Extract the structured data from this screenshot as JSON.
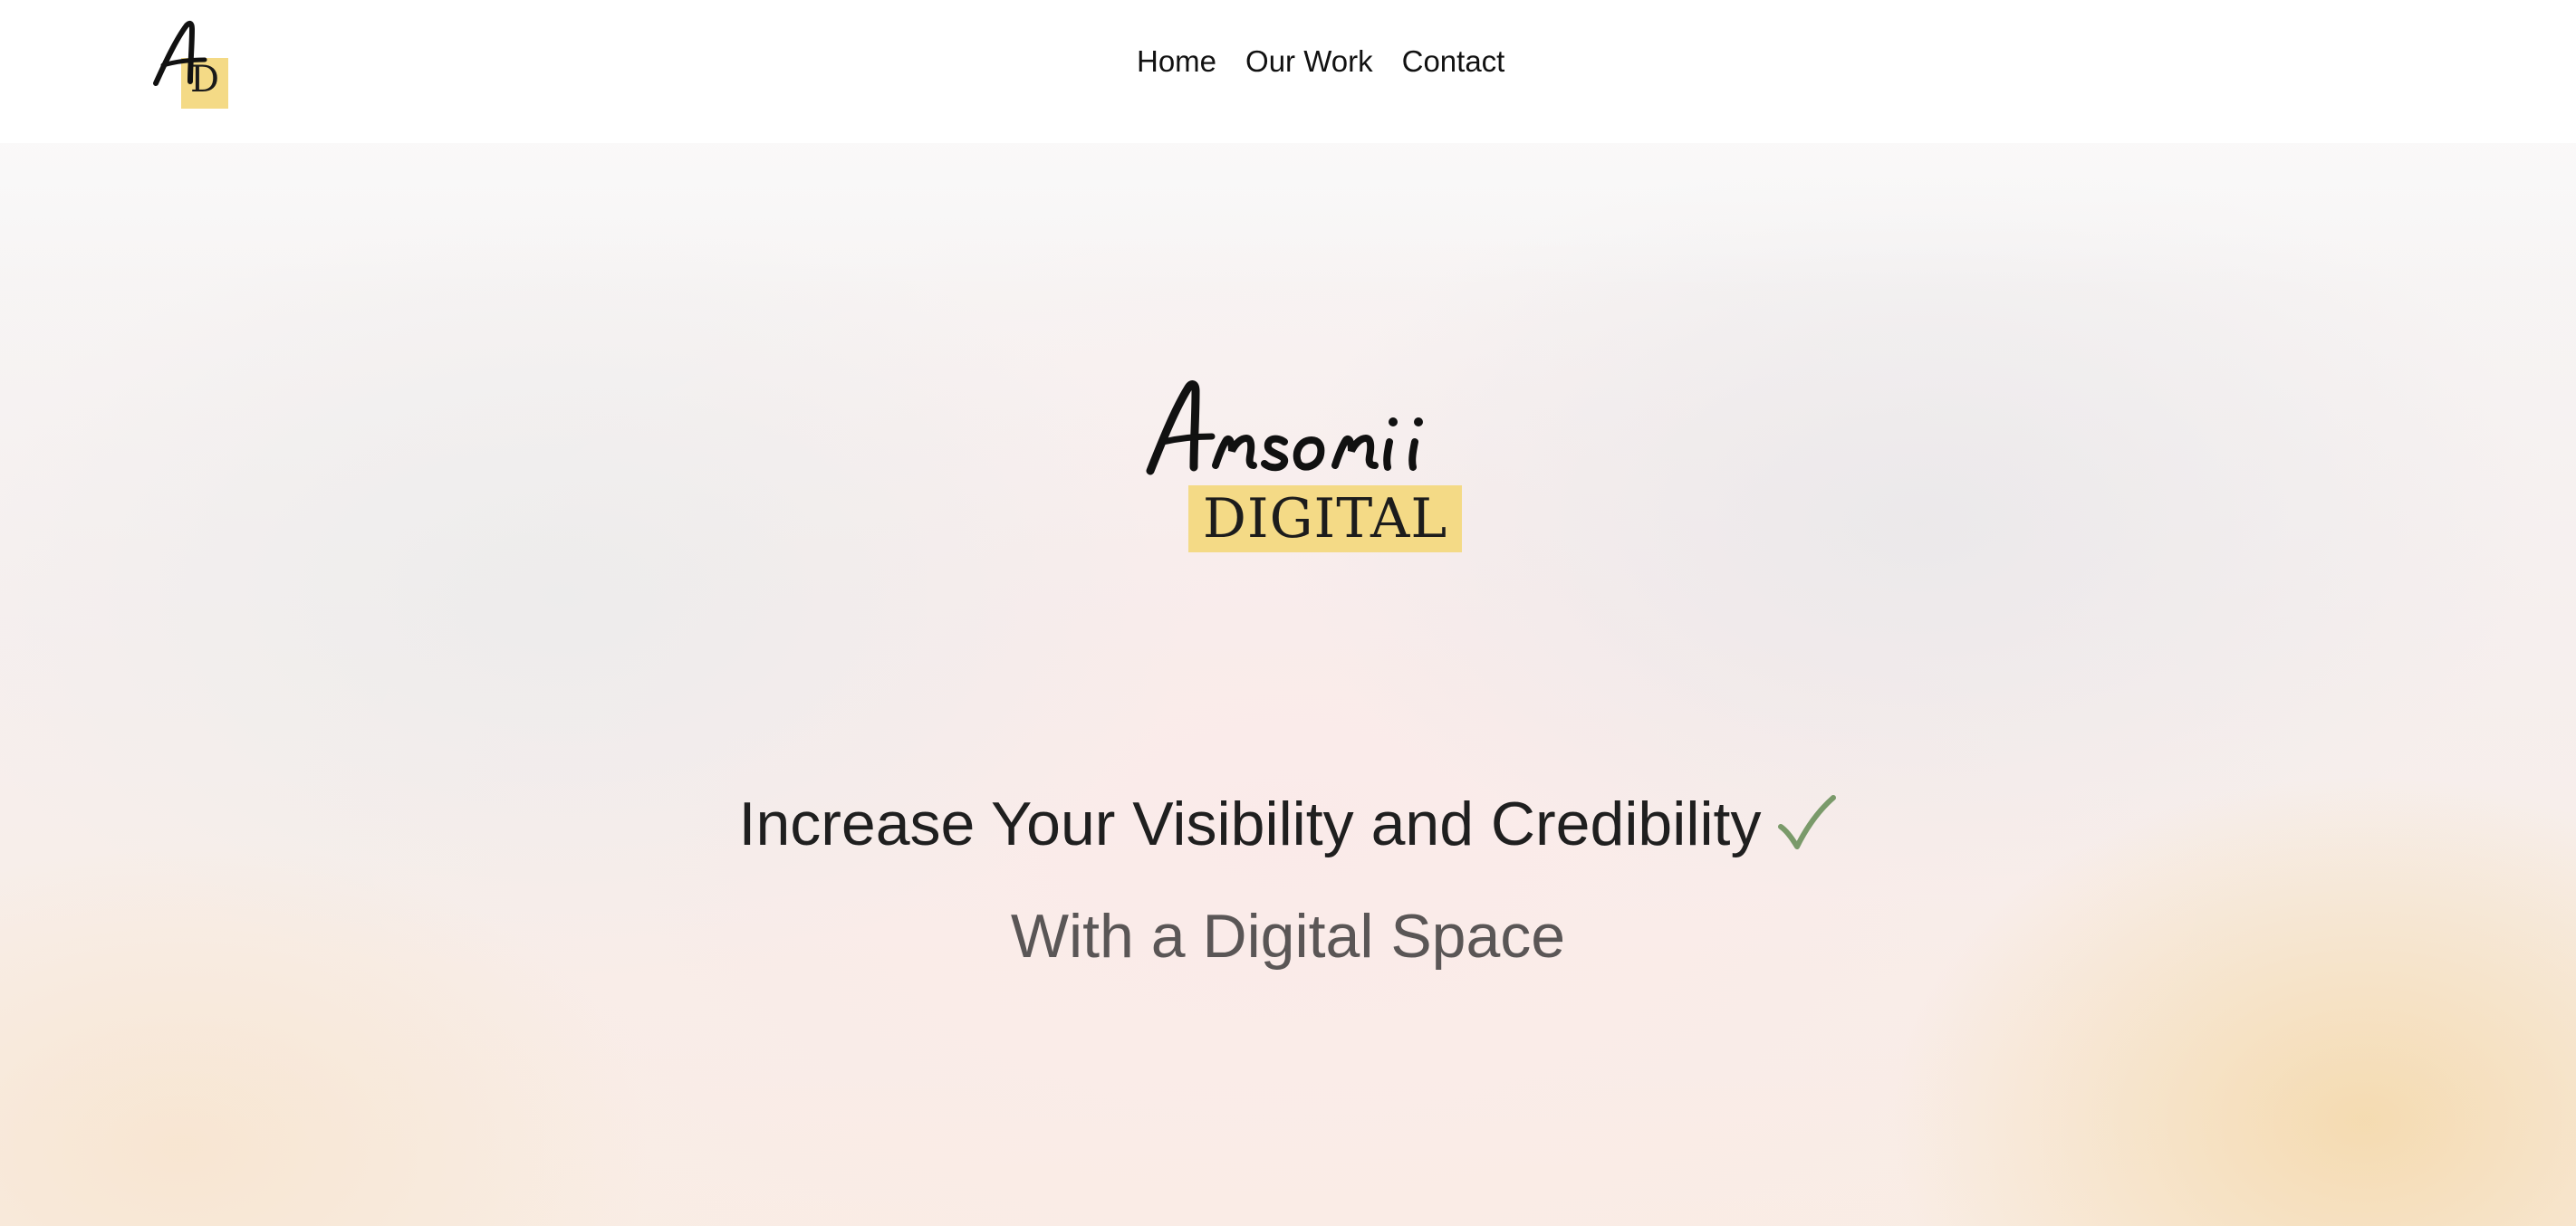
{
  "header": {
    "logo": {
      "letter_a": "A",
      "letter_d": "D"
    },
    "nav": [
      {
        "label": "Home"
      },
      {
        "label": "Our Work"
      },
      {
        "label": "Contact"
      }
    ]
  },
  "hero": {
    "brand": {
      "script": "Ansonii",
      "word": "DIGITAL"
    },
    "headline": "Increase Your Visibility and Credibility",
    "subheadline": "With a Digital Space"
  },
  "colors": {
    "accent_yellow": "#f4da86",
    "check_green": "#7a9a6a",
    "headline_text": "#1f1f1f",
    "subheadline_text": "#5a5656"
  },
  "icons": {
    "check": "check-icon"
  }
}
